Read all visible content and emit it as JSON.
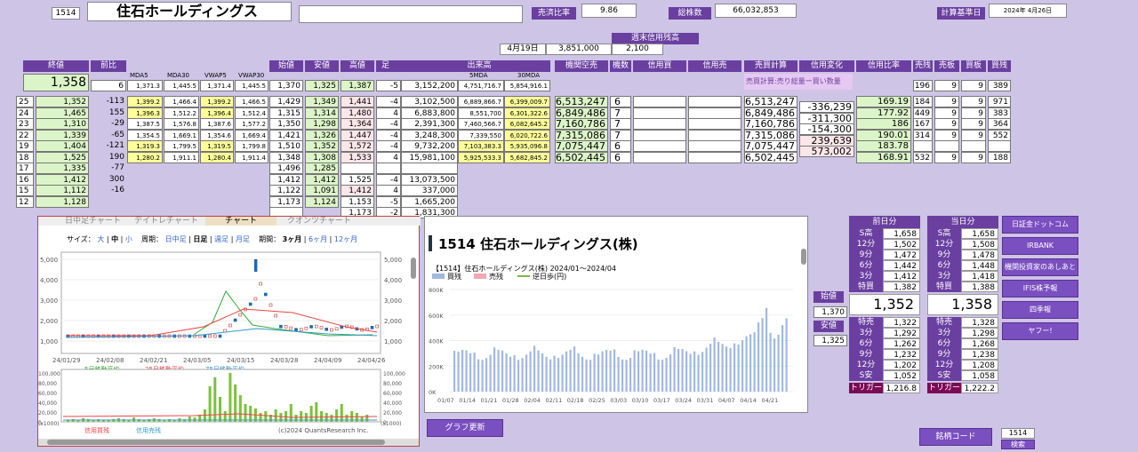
{
  "header": {
    "code": "1514",
    "name": "住石ホールディングス",
    "input_value": "",
    "ratio_label": "売済比率",
    "ratio_value": "9.86",
    "shares_label": "総株数",
    "shares_value": "66,032,853",
    "calc_label": "計算基準日",
    "calc_date": "2024年 4月26日"
  },
  "weekly": {
    "label": "週末信用残高",
    "date": "4月19日",
    "buy": "3,851,000",
    "sell": "2,100"
  },
  "cols": {
    "close": "終値",
    "prev": "前比",
    "mda5": "MDA5",
    "mda30": "MDA30",
    "vwap5": "VWAP5",
    "vwap30": "VWAP30",
    "open": "始値",
    "low": "安値",
    "high": "高値",
    "foot": "足",
    "volume": "出来高",
    "vol5": "5MDA",
    "vol30": "30MDA",
    "inst": "機関空売",
    "count": "機数",
    "cbuy": "信用買",
    "csell": "信用売",
    "bcalc": "売買計算",
    "chg": "信用変化",
    "cratio": "信用比率",
    "bal": "売残",
    "sell_b": "売板",
    "buy_b": "買板",
    "buy_r": "買残"
  },
  "top": {
    "close": "1,358",
    "prev": "6",
    "mda5": "1,371.3",
    "mda30": "1,445.5",
    "vwap5": "1,371.4",
    "vwap30": "1,445.5",
    "open": "1,370",
    "low": "1,325",
    "high": "1,387",
    "foot": "-5",
    "volume": "3,152,200",
    "vol5": "4,751,716.7",
    "vol30": "5,854,916.1",
    "note": "売買計算:売り総量ー買い数量",
    "bal": "196",
    "sb": "9",
    "bb": "9",
    "br": "389"
  },
  "rows": [
    {
      "d": "25",
      "c": "1,352",
      "p": "-113",
      "m5": "1,399.2",
      "m30": "1,466.4",
      "v5": "1,399.2",
      "v30": "1,466.5",
      "o": "1,429",
      "l": "1,349",
      "h": "1,441",
      "f": "-4",
      "vol": "3,102,500",
      "vm5": "6,889,866.7",
      "vm30": "6,399,009.7",
      "inst": "6,513,247",
      "cnt": "6",
      "bc": "6,513,247",
      "chg": "-336,239",
      "cr": "169.19",
      "bal": "184",
      "sb": "9",
      "bb": "9",
      "br": "971"
    },
    {
      "d": "24",
      "c": "1,465",
      "p": "155",
      "m5": "1,396.3",
      "m30": "1,512.2",
      "v5": "1,396.4",
      "v30": "1,512.4",
      "o": "1,315",
      "l": "1,314",
      "h": "1,480",
      "f": "4",
      "vol": "6,883,800",
      "vm5": "8,551,700",
      "vm30": "6,301,322.6",
      "inst": "6,849,486",
      "cnt": "7",
      "bc": "6,849,486",
      "chg": "-311,300",
      "cr": "177.92",
      "bal": "449",
      "sb": "9",
      "bb": "9",
      "br": "383"
    },
    {
      "d": "23",
      "c": "1,310",
      "p": "-29",
      "m5": "1,387.5",
      "m30": "1,576.8",
      "v5": "1,387.6",
      "v30": "1,577.2",
      "o": "1,350",
      "l": "1,298",
      "h": "1,364",
      "f": "-4",
      "vol": "2,391,300",
      "vm5": "7,460,566.7",
      "vm30": "6,082,645.2",
      "inst": "7,160,786",
      "cnt": "7",
      "bc": "7,160,786",
      "chg": "-154,300",
      "cr": "186",
      "bal": "167",
      "sb": "9",
      "bb": "9",
      "br": "364"
    },
    {
      "d": "22",
      "c": "1,339",
      "p": "-65",
      "m5": "1,354.5",
      "m30": "1,669.1",
      "v5": "1,354.6",
      "v30": "1,669.4",
      "o": "1,421",
      "l": "1,326",
      "h": "1,447",
      "f": "-4",
      "vol": "3,248,300",
      "vm5": "7,339,550",
      "vm30": "6,020,722.6",
      "inst": "7,315,086",
      "cnt": "7",
      "bc": "7,315,086",
      "chg": "239,639",
      "cr": "190.01",
      "bal": "314",
      "sb": "9",
      "bb": "9",
      "br": "552"
    },
    {
      "d": "19",
      "c": "1,404",
      "p": "-121",
      "m5": "1,319.3",
      "m30": "1,799.5",
      "v5": "1,319.5",
      "v30": "1,799.8",
      "o": "1,510",
      "l": "1,352",
      "h": "1,572",
      "f": "-4",
      "vol": "9,732,200",
      "vm5": "7,103,383.3",
      "vm30": "5,935,096.8",
      "inst": "7,075,447",
      "cnt": "6",
      "bc": "7,075,447",
      "chg": "573,002",
      "cr": "183.78",
      "bal": "",
      "sb": "",
      "bb": "",
      "br": ""
    },
    {
      "d": "18",
      "c": "1,525",
      "p": "190",
      "m5": "1,280.2",
      "m30": "1,911.1",
      "v5": "1,280.4",
      "v30": "1,911.4",
      "o": "1,348",
      "l": "1,308",
      "h": "1,533",
      "f": "4",
      "vol": "15,981,100",
      "vm5": "5,925,533.3",
      "vm30": "5,682,845.2",
      "inst": "6,502,445",
      "cnt": "6",
      "bc": "6,502,445",
      "chg": "",
      "cr": "168.91",
      "bal": "532",
      "sb": "9",
      "bb": "9",
      "br": "188"
    },
    {
      "d": "17",
      "c": "1,335",
      "p": "-77",
      "o": "1,496",
      "l": "1,285",
      "h": "",
      "f": "",
      "vol": ""
    },
    {
      "d": "16",
      "c": "1,412",
      "p": "300",
      "o": "1,412",
      "l": "1,412",
      "h": "1,525",
      "f": "-4",
      "vol": "13,073,500"
    },
    {
      "d": "15",
      "c": "1,112",
      "p": "-16",
      "o": "1,122",
      "l": "1,091",
      "h": "1,412",
      "f": "4",
      "vol": "337,000"
    },
    {
      "d": "12",
      "c": "1,128",
      "p": "",
      "o": "1,173",
      "l": "1,124",
      "h": "1,153",
      "f": "-5",
      "vol": "1,665,200"
    }
  ],
  "extra_row": {
    "h": "1,173",
    "f": "-2",
    "vol": "1,831,300"
  },
  "chart_left": {
    "tabs": [
      "日中足チャート",
      "デイトレチャート",
      "チャート",
      "クオンツチャート"
    ],
    "size_label": "サイズ：",
    "sizes": [
      "大",
      "中",
      "小"
    ],
    "period_label": "周期：",
    "periods": [
      "日中足",
      "日足",
      "週足",
      "月足"
    ],
    "span_label": "期間：",
    "spans": [
      "3ヶ月",
      "6ヶ月",
      "12ヶ月"
    ],
    "yticks": [
      "5,000",
      "4,000",
      "3,000",
      "2,000",
      "1,000"
    ],
    "xticks": [
      "24/01/29",
      "24/02/08",
      "24/02/21",
      "24/03/05",
      "24/03/15",
      "24/03/28",
      "24/04/09",
      "24/04/26"
    ],
    "legend1": [
      "5日移動平均",
      "25日移動平均",
      "75日移動平均"
    ],
    "vol_yticks": [
      "100,000",
      "80,000",
      "60,000",
      "40,000",
      "20,000",
      "0"
    ],
    "vol_unit": "(x1000)",
    "legend2": [
      "信用買残",
      "信用売残"
    ],
    "copyright": "(c)2024 QuantsResearch Inc."
  },
  "chart_right": {
    "title": "1514 住石ホールディングス(株)",
    "subtitle": "【1514】住石ホールディングス(株) 2024/01～2024/04",
    "legend": [
      "買残",
      "売残",
      "逆日歩(円)"
    ],
    "yticks": [
      "800K",
      "600K",
      "400K",
      "200K",
      "0K"
    ],
    "xticks": [
      "01/07",
      "01/14",
      "01/21",
      "01/28",
      "02/04",
      "02/11",
      "02/18",
      "02/25",
      "03/03",
      "03/10",
      "03/17",
      "03/24",
      "03/31",
      "04/07",
      "04/14",
      "04/21"
    ]
  },
  "buttons": {
    "graph": "グラフ更新",
    "code_label": "銘柄コード",
    "code_value": "1514",
    "search": "検索",
    "links": [
      "日証金ドットコム",
      "IRBANK",
      "機関投資家のあしあと",
      "IFIS株予報",
      "四季報",
      "ヤフー!"
    ]
  },
  "side": {
    "open_label": "始値",
    "open": "1,370",
    "low_label": "安値",
    "low": "1,325"
  },
  "prev_day": {
    "title": "前日分",
    "rows": [
      [
        "S高",
        "1,658"
      ],
      [
        "12分",
        "1,502"
      ],
      [
        "9分",
        "1,472"
      ],
      [
        "6分",
        "1,442"
      ],
      [
        "3分",
        "1,412"
      ],
      [
        "特買",
        "1,382"
      ]
    ],
    "center": "1,352",
    "rows2": [
      [
        "特売",
        "1,322"
      ],
      [
        "3分",
        "1,292"
      ],
      [
        "6分",
        "1,262"
      ],
      [
        "9分",
        "1,232"
      ],
      [
        "12分",
        "1,202"
      ],
      [
        "S安",
        "1,052"
      ]
    ],
    "trig_label": "トリガー",
    "trig": "1,216.8"
  },
  "today": {
    "title": "当日分",
    "rows": [
      [
        "S高",
        "1,658"
      ],
      [
        "12分",
        "1,508"
      ],
      [
        "9分",
        "1,478"
      ],
      [
        "6分",
        "1,448"
      ],
      [
        "3分",
        "1,418"
      ],
      [
        "特買",
        "1,388"
      ]
    ],
    "center": "1,358",
    "rows2": [
      [
        "特売",
        "1,328"
      ],
      [
        "3分",
        "1,298"
      ],
      [
        "6分",
        "1,268"
      ],
      [
        "9分",
        "1,238"
      ],
      [
        "12分",
        "1,208"
      ],
      [
        "S安",
        "1,058"
      ]
    ],
    "trig_label": "トリガー",
    "trig": "1,222.2"
  }
}
